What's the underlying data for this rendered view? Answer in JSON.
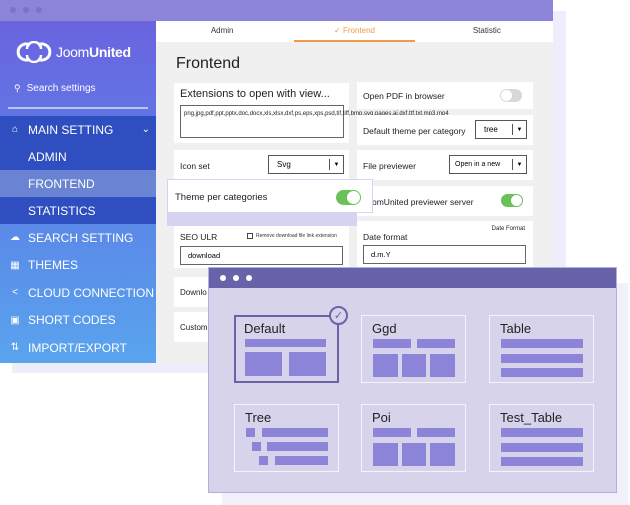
{
  "window": {
    "title_dots": 3
  },
  "sidebar": {
    "logo": {
      "prefix": "Joom",
      "bold": "United"
    },
    "search_placeholder": "Search settings",
    "items": [
      {
        "label": "MAIN SETTING",
        "icon": "home-icon",
        "expanded": true,
        "children": [
          {
            "label": "ADMIN",
            "active": false
          },
          {
            "label": "FRONTEND",
            "active": true
          },
          {
            "label": "STATISTICS",
            "active": false
          }
        ]
      },
      {
        "label": "SEARCH SETTING",
        "icon": "cloud-icon"
      },
      {
        "label": "THEMES",
        "icon": "layout-icon"
      },
      {
        "label": "CLOUD CONNECTION",
        "icon": "share-icon"
      },
      {
        "label": "SHORT CODES",
        "icon": "shortcode-icon"
      },
      {
        "label": "IMPORT/EXPORT",
        "icon": "import-export-icon"
      }
    ]
  },
  "tabs": [
    {
      "label": "Admin",
      "active": false
    },
    {
      "label": "✓ Frontend",
      "active": true
    },
    {
      "label": "Statistic",
      "active": false
    }
  ],
  "page_title": "Frontend",
  "settings": {
    "extensions": {
      "label": "Extensions to open with view...",
      "value": "png,jpg,pdf,ppt,pptx,doc,docx,xls,xlsx,dxf,ps,eps,xps,psd,tif,tiff,bmp,svg,pages,ai,dxf,ttf,txt,mp3,mp4"
    },
    "icon_set": {
      "label": "Icon set",
      "value": "Svg"
    },
    "theme_per_categories": {
      "label": "Theme per categories",
      "enabled": true
    },
    "seo_url": {
      "label": "SEO ULR",
      "checkbox_label": "Remove download file link extension",
      "checked": false,
      "value": "download"
    },
    "download_partial": {
      "label": "Downlo"
    },
    "custom_partial": {
      "label": "Custom"
    },
    "open_pdf": {
      "label": "Open PDF in browser",
      "enabled": false
    },
    "default_theme": {
      "label": "Default theme per category",
      "value": "tree"
    },
    "file_previewer": {
      "label": "File previewer",
      "value": "Open in a new"
    },
    "previewer_server": {
      "label": "JoomUnited previewer server",
      "visible_label": "omUnited previewer server",
      "enabled": true
    },
    "date_format": {
      "label": "Date format",
      "link": "Date Format",
      "value": "d.m.Y"
    }
  },
  "themes": [
    {
      "name": "Default",
      "selected": true
    },
    {
      "name": "Ggd",
      "selected": false
    },
    {
      "name": "Table",
      "selected": false
    },
    {
      "name": "Tree",
      "selected": false
    },
    {
      "name": "Poi",
      "selected": false
    },
    {
      "name": "Test_Table",
      "selected": false
    }
  ],
  "colors": {
    "accent": "#f09a4a",
    "brand_purple": "#8b84d8",
    "dark_purple": "#6863a8",
    "toggle_on": "#6cc05a"
  }
}
